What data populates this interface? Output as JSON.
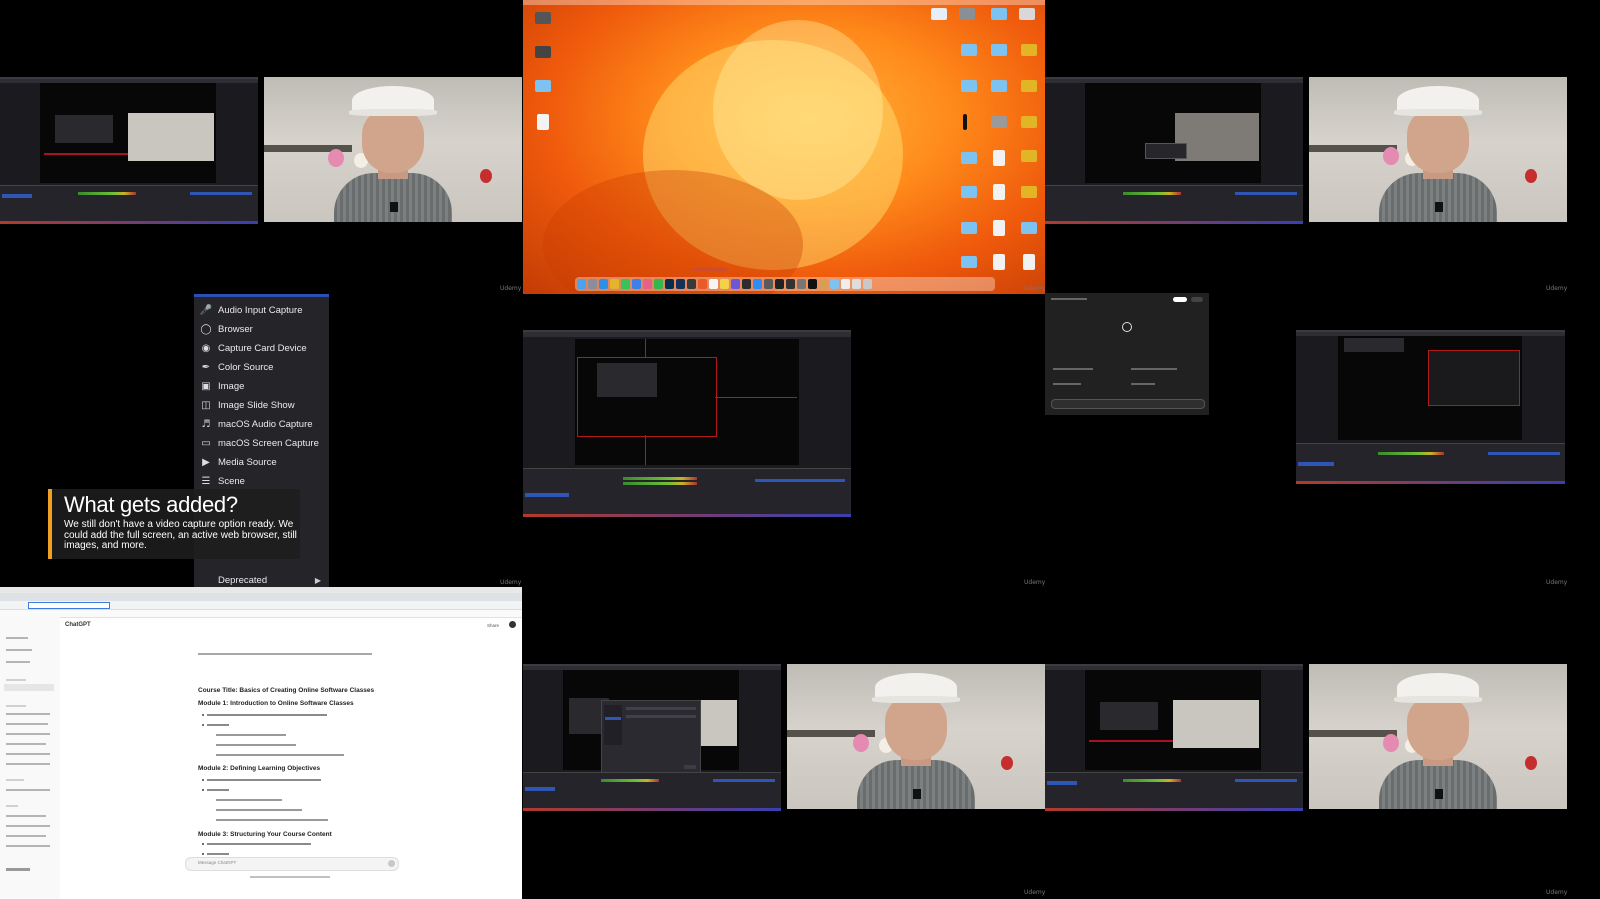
{
  "watermark": "Udemy",
  "source_menu": {
    "items": [
      {
        "label": "Audio Input Capture",
        "icon": "microphone-icon"
      },
      {
        "label": "Browser",
        "icon": "globe-icon"
      },
      {
        "label": "Capture Card Device",
        "icon": "camera-icon"
      },
      {
        "label": "Color Source",
        "icon": "paintbrush-icon"
      },
      {
        "label": "Image",
        "icon": "image-icon"
      },
      {
        "label": "Image Slide Show",
        "icon": "slideshow-icon"
      },
      {
        "label": "macOS Audio Capture",
        "icon": "speaker-icon"
      },
      {
        "label": "macOS Screen Capture",
        "icon": "monitor-icon"
      },
      {
        "label": "Media Source",
        "icon": "play-icon"
      },
      {
        "label": "Scene",
        "icon": "list-icon"
      }
    ],
    "deprecated_label": "Deprecated"
  },
  "caption": {
    "title": "What gets added?",
    "body": "We still don't have a video capture option ready. We could add the full screen, an active web browser, still images, and more."
  },
  "chatgpt_browser": {
    "app_title": "ChatGPT",
    "share_label": "Share",
    "input_placeholder": "Message ChatGPT",
    "course_title": "Course Title: Basics of Creating Online Software Classes",
    "module_1": "Module 1: Introduction to Online Software Classes",
    "module_2": "Module 2: Defining Learning Objectives",
    "module_3": "Module 3: Structuring Your Course Content"
  },
  "colors": {
    "menu_bg": "#242429",
    "menu_accent": "#2c4fb3",
    "caption_accent": "#f0a020",
    "desktop_orange": "#ff8a1a"
  }
}
